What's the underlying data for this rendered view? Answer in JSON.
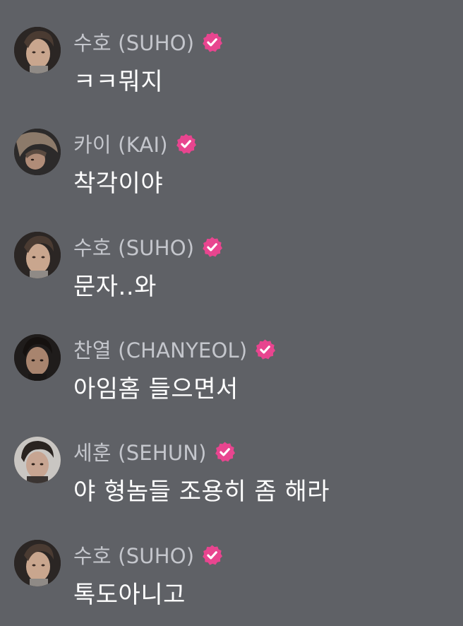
{
  "colors": {
    "background": "#5f6166",
    "name_text": "#c4c6cc",
    "message_text": "#ffffff",
    "verified_badge": "#e8458f"
  },
  "messages": [
    {
      "sender": "수호 (SUHO)",
      "text": "ㅋㅋ뭐지",
      "avatar": "suho-avatar-icon",
      "verified_icon": "verified-badge-icon"
    },
    {
      "sender": "카이 (KAI)",
      "text": "착각이야",
      "avatar": "kai-avatar-icon",
      "verified_icon": "verified-badge-icon"
    },
    {
      "sender": "수호 (SUHO)",
      "text": "문자..와",
      "avatar": "suho-avatar-icon",
      "verified_icon": "verified-badge-icon"
    },
    {
      "sender": "찬열 (CHANYEOL)",
      "text": "아임홈 들으면서",
      "avatar": "chanyeol-avatar-icon",
      "verified_icon": "verified-badge-icon"
    },
    {
      "sender": "세훈 (SEHUN)",
      "text": "야 형놈들 조용히 좀 해라",
      "avatar": "sehun-avatar-icon",
      "verified_icon": "verified-badge-icon"
    },
    {
      "sender": "수호 (SUHO)",
      "text": "톡도아니고",
      "avatar": "suho-avatar-icon",
      "verified_icon": "verified-badge-icon"
    }
  ]
}
